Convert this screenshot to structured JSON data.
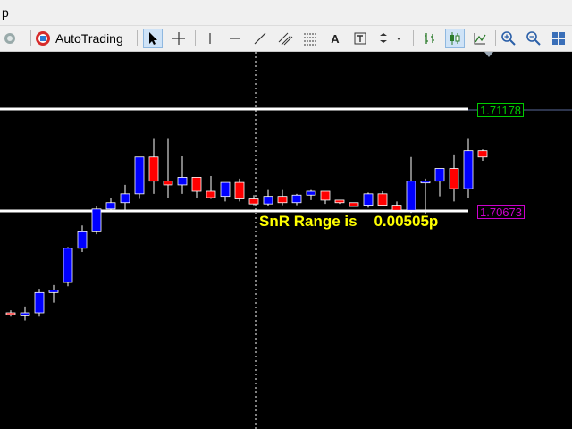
{
  "menubar": {
    "partial_item": "p"
  },
  "toolbar": {
    "autotrading_label": "AutoTrading",
    "text_tool_label": "A"
  },
  "chart": {
    "upper_level": "1.71178",
    "lower_level": "1.70673",
    "range_text": "SnR Range is    0.00505p",
    "colors": {
      "background": "#000000",
      "bull": "#0000ff",
      "bear": "#ff0000",
      "wick": "#ffffff",
      "upper_tag": "#00cc00",
      "lower_tag": "#cc00cc",
      "range_text": "#ffff00"
    }
  },
  "chart_data": {
    "type": "candlestick",
    "price_min": 1.7032,
    "price_max": 1.7152,
    "candles": [
      {
        "o": 1.7056,
        "h": 1.7057,
        "l": 1.70545,
        "c": 1.70555
      },
      {
        "o": 1.70548,
        "h": 1.70585,
        "l": 1.7053,
        "c": 1.7056
      },
      {
        "o": 1.7056,
        "h": 1.70655,
        "l": 1.70545,
        "c": 1.7064
      },
      {
        "o": 1.7064,
        "h": 1.7067,
        "l": 1.706,
        "c": 1.7065
      },
      {
        "o": 1.7068,
        "h": 1.7082,
        "l": 1.70665,
        "c": 1.70815
      },
      {
        "o": 1.70815,
        "h": 1.70905,
        "l": 1.708,
        "c": 1.7088
      },
      {
        "o": 1.7088,
        "h": 1.7098,
        "l": 1.7087,
        "c": 1.7097
      },
      {
        "o": 1.7097,
        "h": 1.71015,
        "l": 1.7096,
        "c": 1.70995
      },
      {
        "o": 1.70995,
        "h": 1.71065,
        "l": 1.7096,
        "c": 1.7103
      },
      {
        "o": 1.7103,
        "h": 1.71135,
        "l": 1.7101,
        "c": 1.71175
      },
      {
        "o": 1.71175,
        "h": 1.7125,
        "l": 1.7103,
        "c": 1.7108
      },
      {
        "o": 1.7108,
        "h": 1.7125,
        "l": 1.71015,
        "c": 1.71065
      },
      {
        "o": 1.71065,
        "h": 1.7118,
        "l": 1.7103,
        "c": 1.71095
      },
      {
        "o": 1.71095,
        "h": 1.7109,
        "l": 1.71015,
        "c": 1.7104
      },
      {
        "o": 1.7104,
        "h": 1.711,
        "l": 1.7101,
        "c": 1.71015
      },
      {
        "o": 1.7102,
        "h": 1.7107,
        "l": 1.71,
        "c": 1.71075
      },
      {
        "o": 1.71075,
        "h": 1.7109,
        "l": 1.71,
        "c": 1.7101
      },
      {
        "o": 1.7101,
        "h": 1.71025,
        "l": 1.70985,
        "c": 1.7099
      },
      {
        "o": 1.7099,
        "h": 1.71045,
        "l": 1.7098,
        "c": 1.7102
      },
      {
        "o": 1.7102,
        "h": 1.71045,
        "l": 1.70985,
        "c": 1.70995
      },
      {
        "o": 1.70995,
        "h": 1.7103,
        "l": 1.70985,
        "c": 1.71025
      },
      {
        "o": 1.71025,
        "h": 1.71045,
        "l": 1.71005,
        "c": 1.7104
      },
      {
        "o": 1.7104,
        "h": 1.7103,
        "l": 1.7099,
        "c": 1.71005
      },
      {
        "o": 1.71005,
        "h": 1.71,
        "l": 1.7099,
        "c": 1.70995
      },
      {
        "o": 1.70995,
        "h": 1.7099,
        "l": 1.7098,
        "c": 1.7098
      },
      {
        "o": 1.70985,
        "h": 1.71035,
        "l": 1.70975,
        "c": 1.7103
      },
      {
        "o": 1.7103,
        "h": 1.7104,
        "l": 1.7098,
        "c": 1.70985
      },
      {
        "o": 1.70985,
        "h": 1.71,
        "l": 1.7096,
        "c": 1.70965
      },
      {
        "o": 1.70965,
        "h": 1.71175,
        "l": 1.70955,
        "c": 1.7108
      },
      {
        "o": 1.7108,
        "h": 1.7109,
        "l": 1.7095,
        "c": 1.7108
      },
      {
        "o": 1.7108,
        "h": 1.7111,
        "l": 1.7102,
        "c": 1.7113
      },
      {
        "o": 1.7113,
        "h": 1.71185,
        "l": 1.71,
        "c": 1.7105
      },
      {
        "o": 1.7105,
        "h": 1.7125,
        "l": 1.71015,
        "c": 1.712
      },
      {
        "o": 1.712,
        "h": 1.71205,
        "l": 1.7116,
        "c": 1.71175
      }
    ]
  }
}
